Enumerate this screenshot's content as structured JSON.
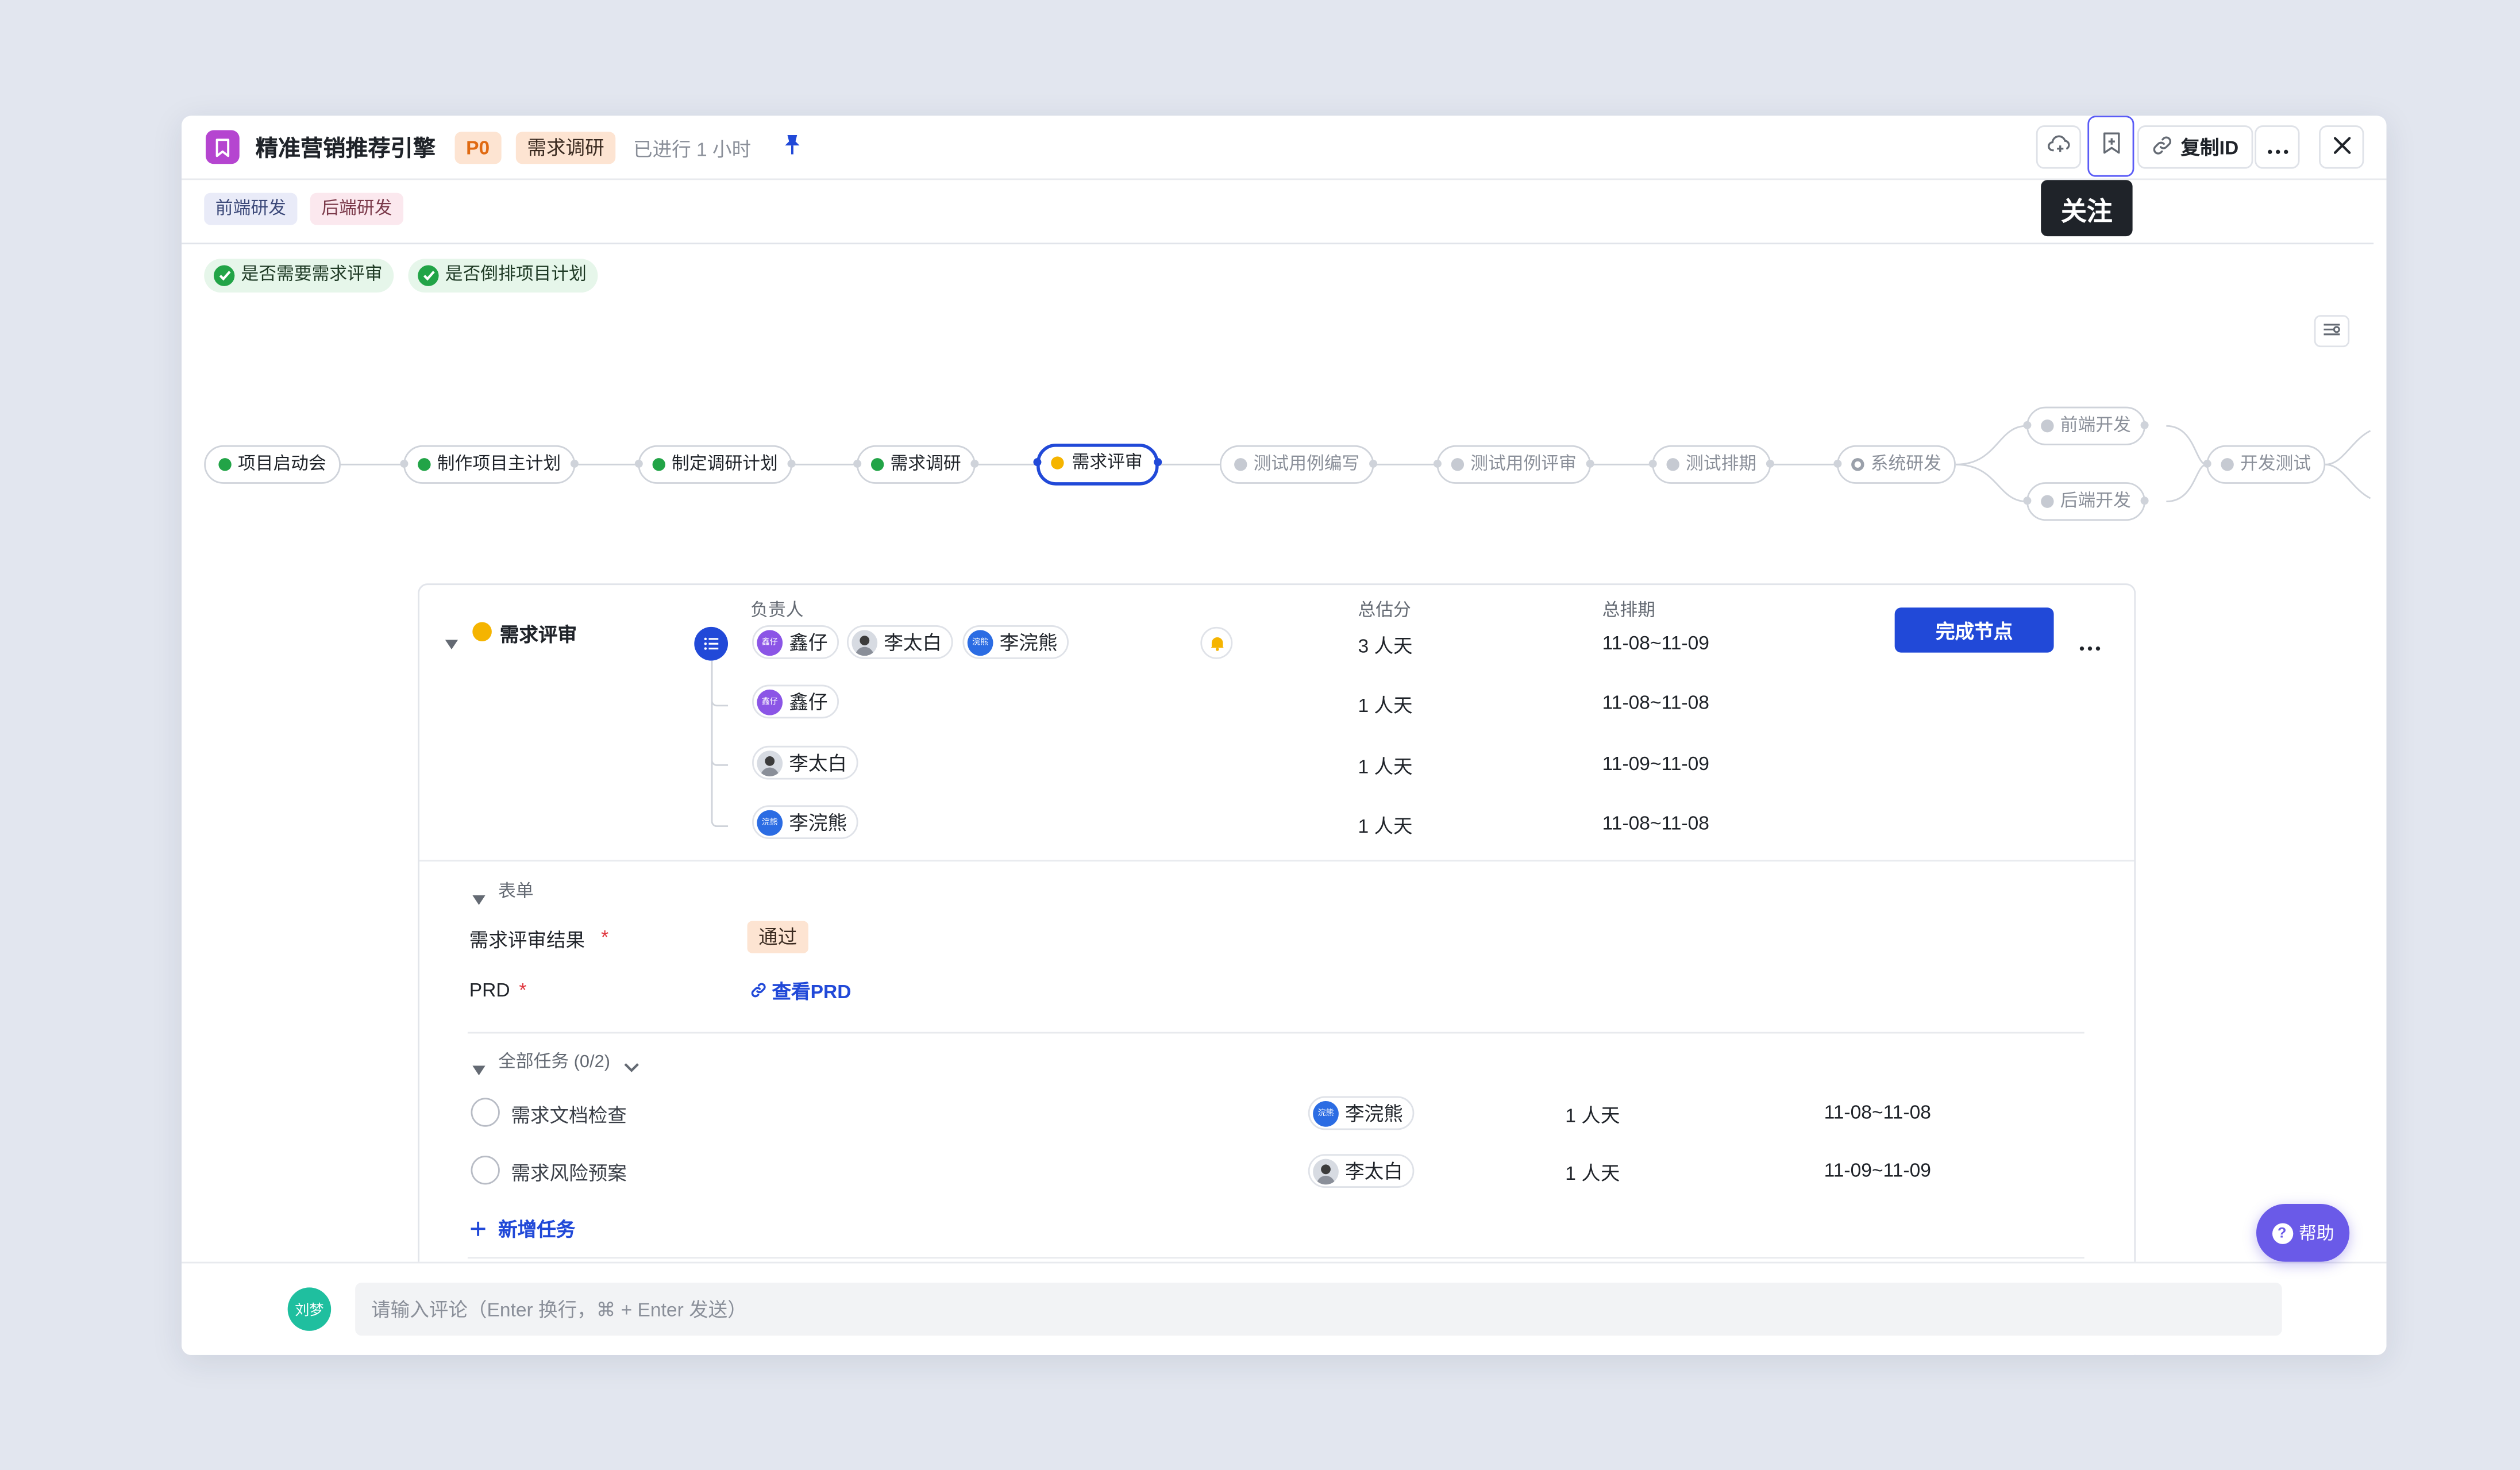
{
  "header": {
    "title": "精准营销推荐引擎",
    "priority": "P0",
    "stage": "需求调研",
    "elapsed": "已进行 1 小时",
    "copy_id_label": "复制ID",
    "follow_tooltip": "关注"
  },
  "tags": [
    "前端研发",
    "后端研发"
  ],
  "checks": [
    "是否需要需求评审",
    "是否倒排项目计划"
  ],
  "workflow": {
    "nodes": [
      {
        "label": "项目启动会",
        "status": "done"
      },
      {
        "label": "制作项目主计划",
        "status": "done"
      },
      {
        "label": "制定调研计划",
        "status": "done"
      },
      {
        "label": "需求调研",
        "status": "done"
      },
      {
        "label": "需求评审",
        "status": "current"
      },
      {
        "label": "测试用例编写",
        "status": "pending"
      },
      {
        "label": "测试用例评审",
        "status": "pending"
      },
      {
        "label": "测试排期",
        "status": "pending"
      },
      {
        "label": "系统研发",
        "status": "pending"
      },
      {
        "label": "前端开发",
        "status": "pending"
      },
      {
        "label": "后端开发",
        "status": "pending"
      },
      {
        "label": "开发测试",
        "status": "pending"
      }
    ]
  },
  "node_detail": {
    "name": "需求评审",
    "col_owner": "负责人",
    "col_estimate": "总估分",
    "col_schedule": "总排期",
    "complete_label": "完成节点",
    "owners": [
      {
        "name": "鑫仔",
        "badge": "鑫仔"
      },
      {
        "name": "李太白",
        "badge": ""
      },
      {
        "name": "李浣熊",
        "badge": "浣熊"
      }
    ],
    "total_estimate": "3 人天",
    "total_schedule": "11-08~11-09",
    "rows": [
      {
        "name": "鑫仔",
        "badge": "鑫仔",
        "estimate": "1 人天",
        "schedule": "11-08~11-08"
      },
      {
        "name": "李太白",
        "badge": "",
        "estimate": "1 人天",
        "schedule": "11-09~11-09"
      },
      {
        "name": "李浣熊",
        "badge": "浣熊",
        "estimate": "1 人天",
        "schedule": "11-08~11-08"
      }
    ]
  },
  "form": {
    "section_label": "表单",
    "review_result_label": "需求评审结果",
    "review_result_value": "通过",
    "prd_label": "PRD",
    "prd_link": "查看PRD",
    "required_mark": "*"
  },
  "tasks": {
    "section_label": "全部任务 (0/2)",
    "items": [
      {
        "name": "需求文档检查",
        "owner": "李浣熊",
        "badge": "浣熊",
        "estimate": "1 人天",
        "schedule": "11-08~11-08"
      },
      {
        "name": "需求风险预案",
        "owner": "李太白",
        "badge": "",
        "estimate": "1 人天",
        "schedule": "11-09~11-09"
      }
    ],
    "add_label": "新增任务"
  },
  "comment": {
    "user": "刘梦",
    "placeholder": "请输入评论（Enter 换行，⌘ + Enter 发送）"
  },
  "help_label": "帮助",
  "colors": {
    "accent": "#2149d8",
    "done": "#22a447",
    "current": "#f5b400",
    "pending": "#c6cad2",
    "background": "#e2e6ef"
  }
}
